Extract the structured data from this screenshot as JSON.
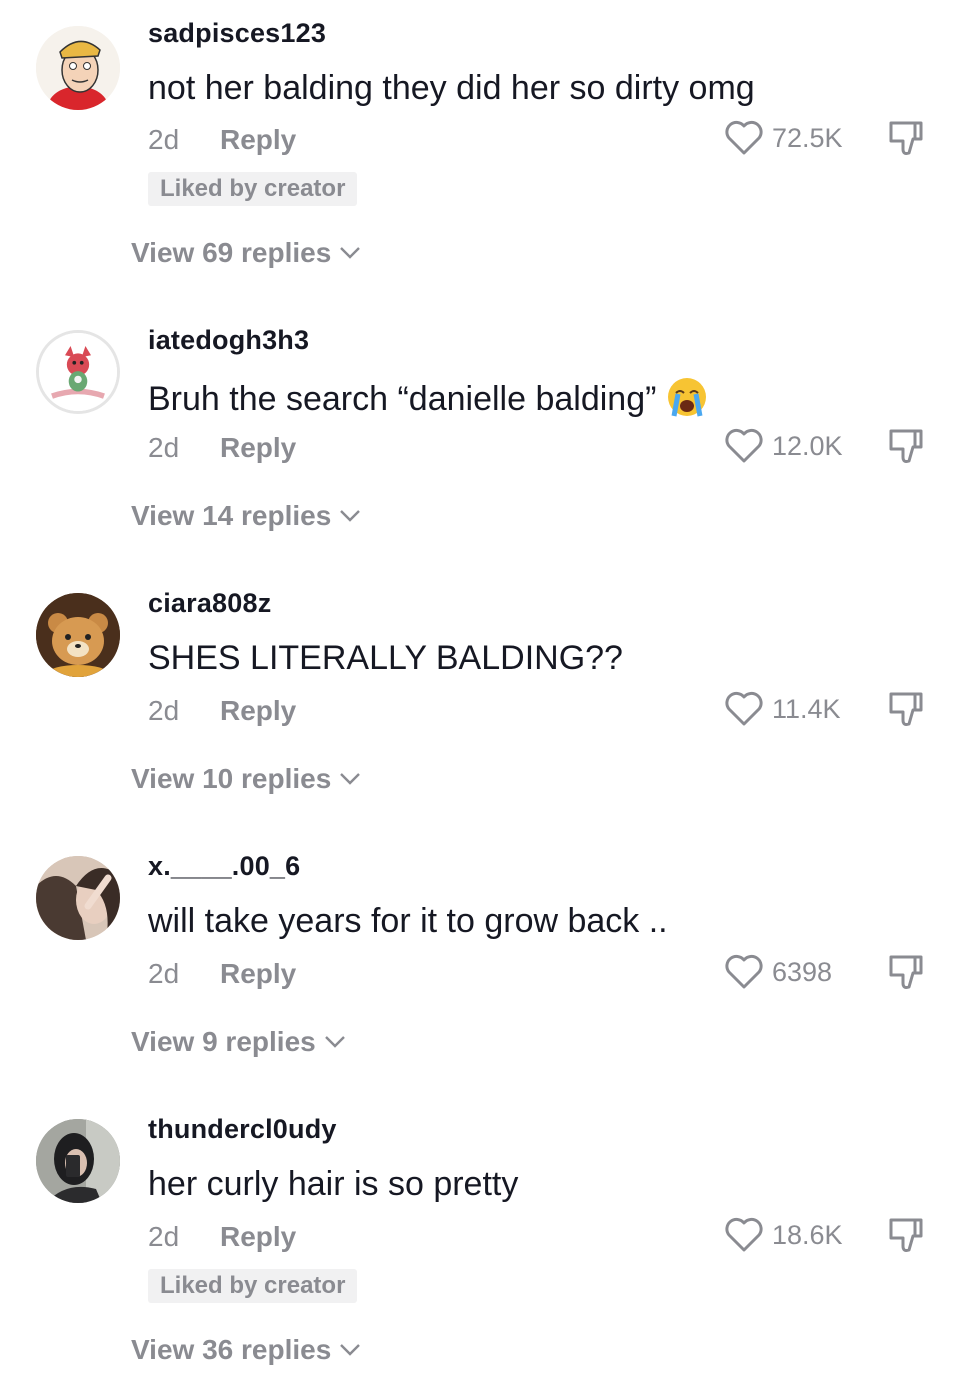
{
  "colors": {
    "text_primary": "#161823",
    "text_secondary": "#8a8b91",
    "badge_bg": "#f1f1f2",
    "background": "#ffffff"
  },
  "comments": [
    {
      "username": "sadpisces123",
      "text": "not her balding they did her so dirty omg",
      "time": "2d",
      "reply_label": "Reply",
      "likes": "72.5K",
      "liked_by_creator": true,
      "badge_label": "Liked by creator",
      "view_replies": "View 69 replies",
      "avatar": "cartoon-man-avatar"
    },
    {
      "username": "iatedogh3h3",
      "text": "Bruh the search “danielle balding”",
      "emoji": "loudly-crying-face-emoji",
      "time": "2d",
      "reply_label": "Reply",
      "likes": "12.0K",
      "liked_by_creator": false,
      "view_replies": "View 14 replies",
      "avatar": "plush-toy-avatar"
    },
    {
      "username": "ciara808z",
      "text": "SHES LITERALLY BALDING??",
      "time": "2d",
      "reply_label": "Reply",
      "likes": "11.4K",
      "liked_by_creator": false,
      "view_replies": "View 10 replies",
      "avatar": "teddy-bear-avatar"
    },
    {
      "username": "x.____.00_6",
      "text": "will take years for it to grow back ..",
      "time": "2d",
      "reply_label": "Reply",
      "likes": "6398",
      "liked_by_creator": false,
      "view_replies": "View 9 replies",
      "avatar": "photo-avatar"
    },
    {
      "username": "thundercl0udy",
      "text": "her curly hair is so pretty",
      "time": "2d",
      "reply_label": "Reply",
      "likes": "18.6K",
      "liked_by_creator": true,
      "badge_label": "Liked by creator",
      "view_replies": "View 36 replies",
      "avatar": "mirror-selfie-avatar"
    }
  ]
}
